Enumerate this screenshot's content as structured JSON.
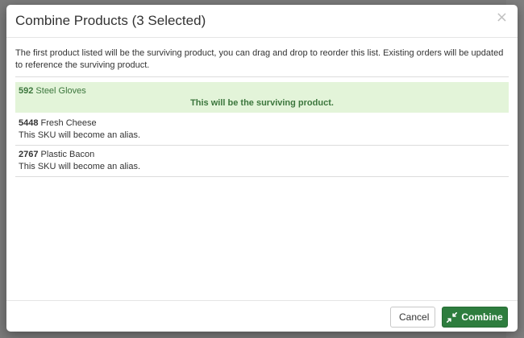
{
  "modal": {
    "title": "Combine Products (3 Selected)",
    "close_glyph": "×",
    "intro": "The first product listed will be the surviving product, you can drag and drop to reorder this list. Existing orders will be updated to reference the surviving product.",
    "products": [
      {
        "sku": "592",
        "name": "Steel Gloves",
        "note": "This will be the surviving product.",
        "surviving": true
      },
      {
        "sku": "5448",
        "name": "Fresh Cheese",
        "note": "This SKU will become an alias.",
        "surviving": false
      },
      {
        "sku": "2767",
        "name": "Plastic Bacon",
        "note": "This SKU will become an alias.",
        "surviving": false
      }
    ],
    "footer": {
      "cancel_label": "Cancel",
      "combine_label": "Combine",
      "combine_icon": "compress-arrows-icon"
    }
  },
  "colors": {
    "surviving_bg": "#e3f4d9",
    "surviving_text": "#3c763d",
    "combine_button": "#2e7d3e"
  }
}
